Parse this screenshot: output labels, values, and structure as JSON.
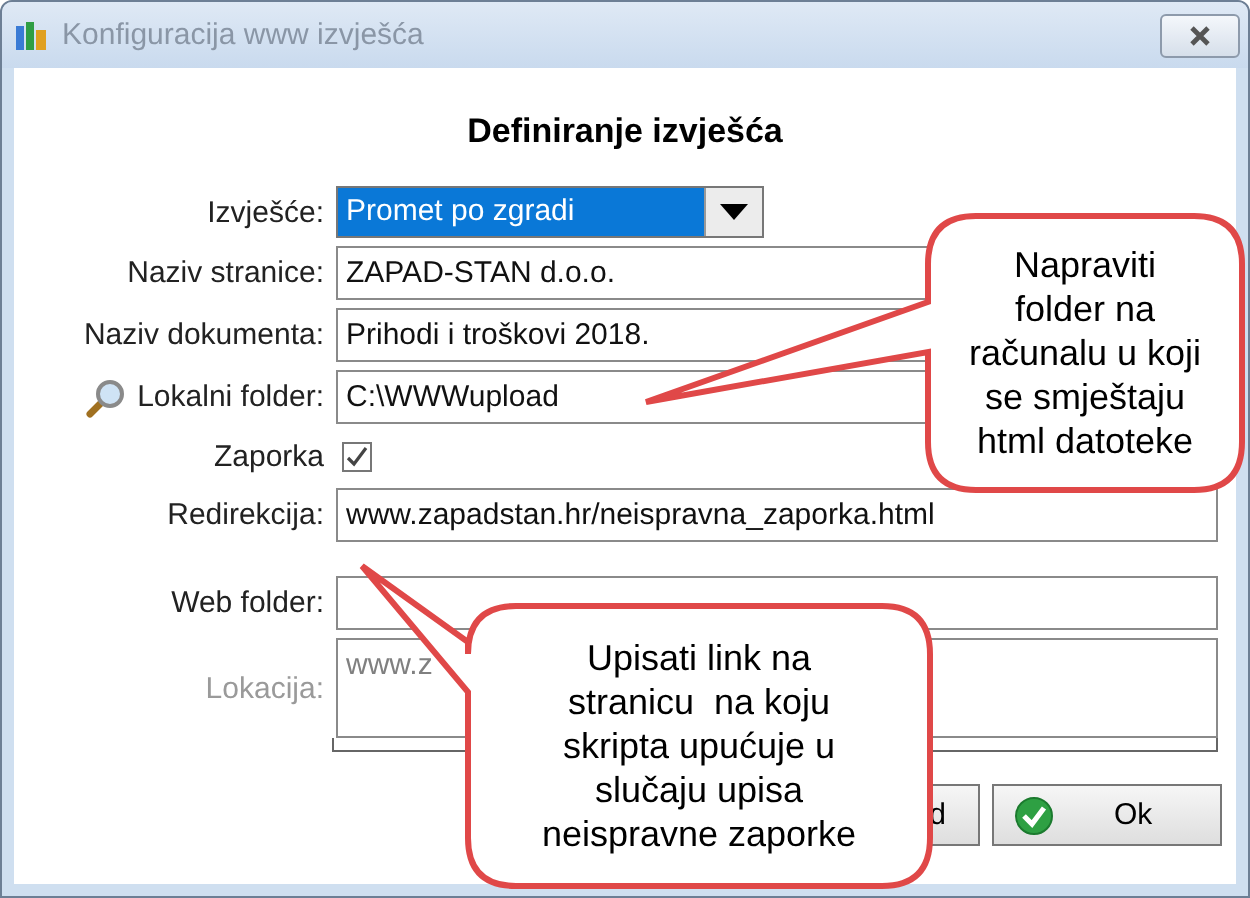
{
  "window": {
    "title": "Konfiguracija www izvješća"
  },
  "heading": "Definiranje izvješća",
  "fields": [
    {
      "kind": "combo",
      "label": "Izvješće:",
      "value": "Promet po zgradi"
    },
    {
      "kind": "text",
      "label": "Naziv stranice:",
      "value": "ZAPAD-STAN d.o.o."
    },
    {
      "kind": "text",
      "label": "Naziv dokumenta:",
      "value": "Prihodi i troškovi 2018."
    },
    {
      "kind": "folder",
      "label": "Lokalni folder:",
      "value": "C:\\WWWupload"
    },
    {
      "kind": "checkbox",
      "label": "Zaporka",
      "checked": true
    },
    {
      "kind": "text",
      "label": "Redirekcija:",
      "value": "www.zapadstan.hr/neispravna_zaporka.html"
    }
  ],
  "web_fields": [
    {
      "kind": "text",
      "label": "Web folder:"
    },
    {
      "kind": "area",
      "label": "Lokacija:",
      "value": "www.z",
      "disabled": true
    }
  ],
  "buttons": [
    {
      "kind": "plain",
      "label": "d"
    },
    {
      "kind": "ok",
      "label": "Ok"
    }
  ],
  "callouts": [
    {
      "text": "Napraviti\nfolder na\nračunalu u koji\nse smještaju\nhtml datoteke"
    },
    {
      "text": "Upisati link na\nstranicu  na koju\nskripta upućuje u\nslučaju upisa\nneispravne zaporke"
    }
  ]
}
